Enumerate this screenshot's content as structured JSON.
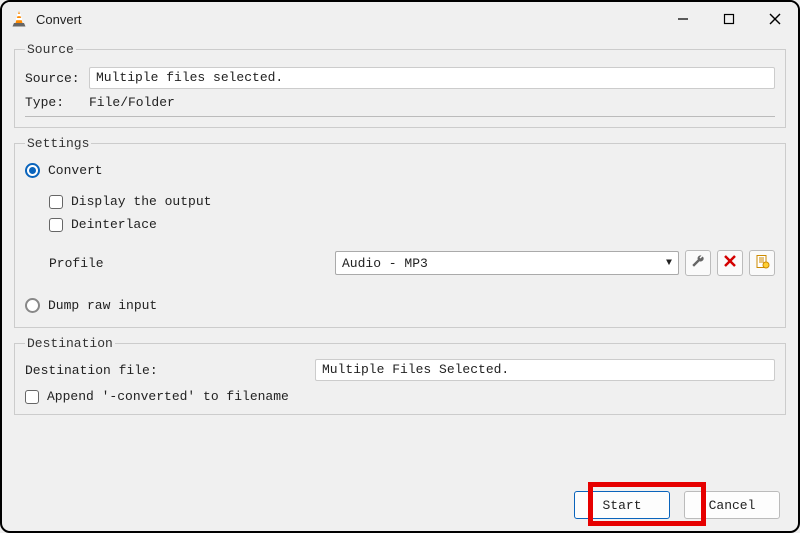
{
  "window": {
    "title": "Convert"
  },
  "source": {
    "legend": "Source",
    "source_label": "Source:",
    "source_value": "Multiple files selected.",
    "type_label": "Type:",
    "type_value": "File/Folder"
  },
  "settings": {
    "legend": "Settings",
    "convert_label": "Convert",
    "display_output_label": "Display the output",
    "deinterlace_label": "Deinterlace",
    "profile_label": "Profile",
    "profile_value": "Audio - MP3",
    "dump_raw_label": "Dump raw input"
  },
  "destination": {
    "legend": "Destination",
    "file_label": "Destination file:",
    "file_value": "Multiple Files Selected.",
    "append_label": "Append '-converted' to filename"
  },
  "footer": {
    "start": "Start",
    "cancel": "Cancel"
  }
}
